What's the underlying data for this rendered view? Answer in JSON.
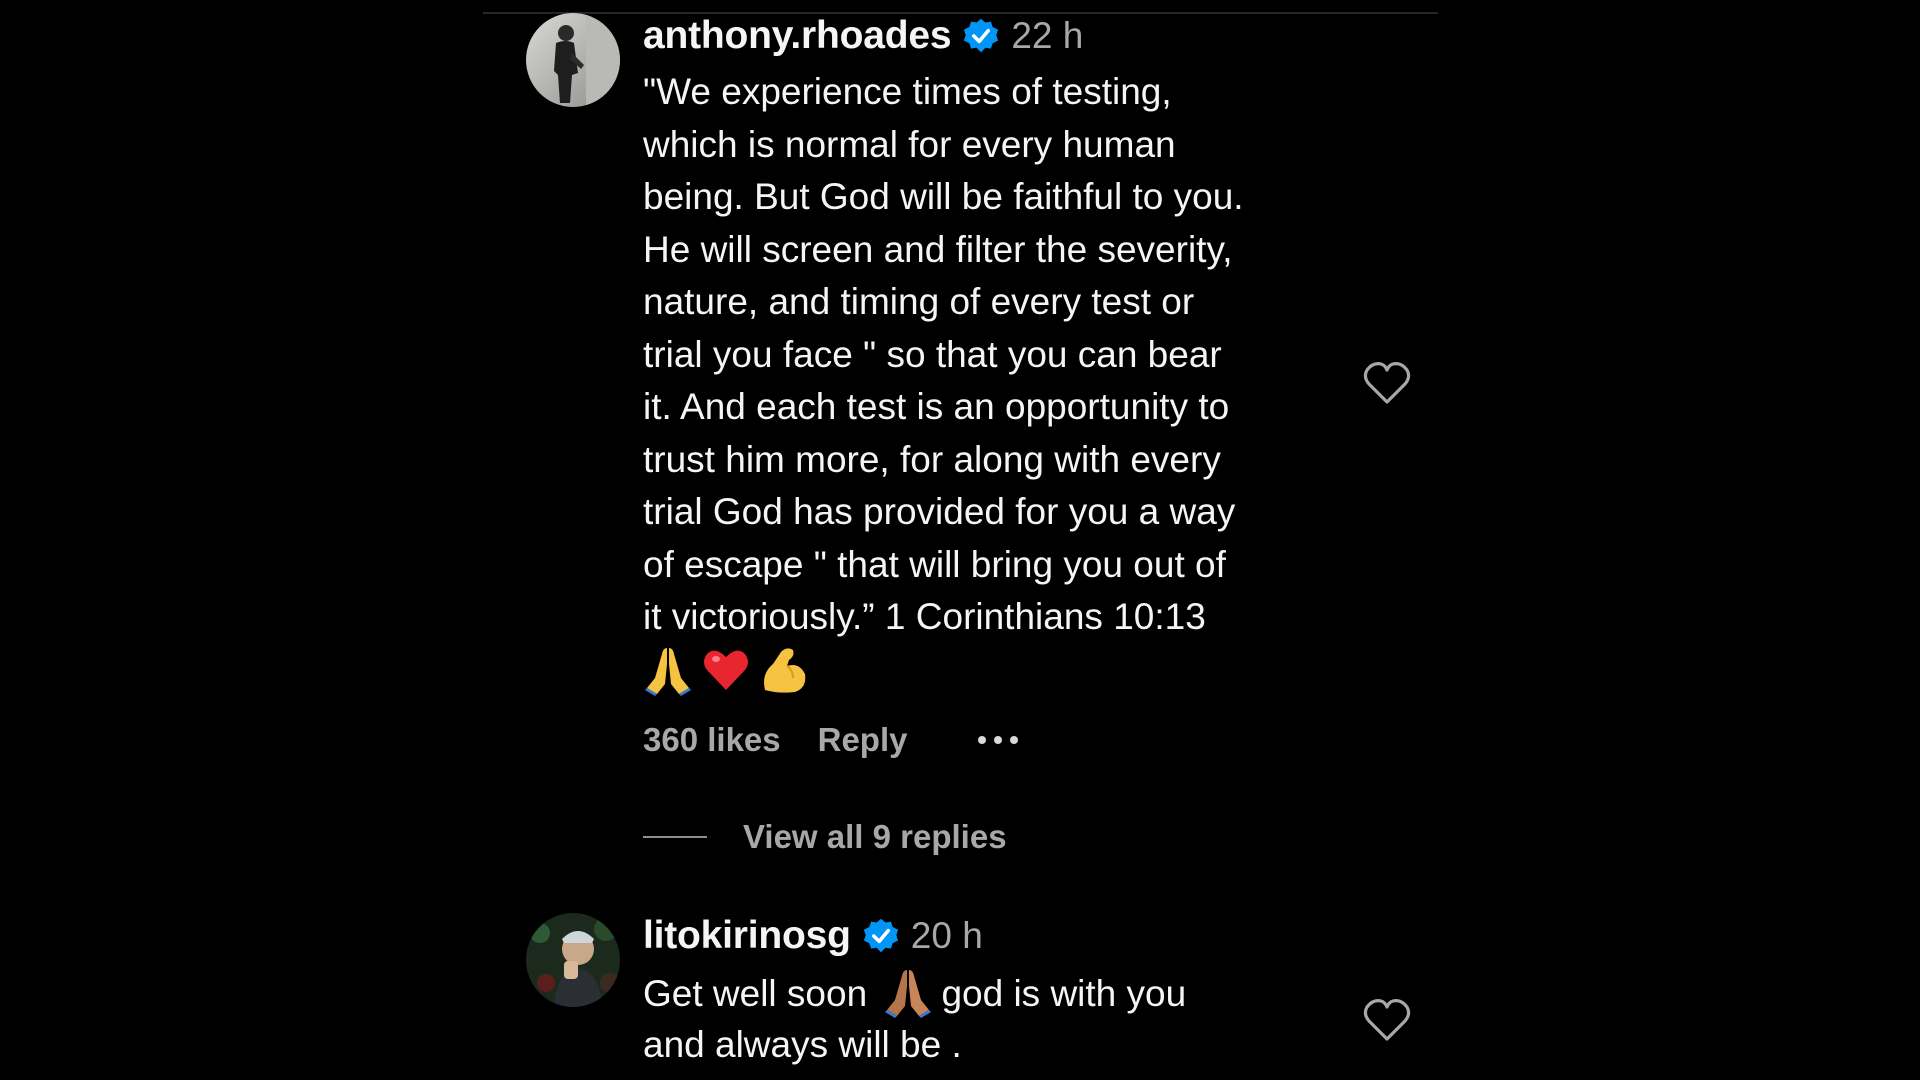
{
  "comments": [
    {
      "username": "anthony.rhoades",
      "verified": true,
      "time": "22 h",
      "text_lines": [
        "\"We experience times of testing,",
        "which is normal for every human",
        "being. But God will be faithful to you.",
        "He will screen and filter the severity,",
        "nature, and timing of every test or",
        "trial you face \" so that you can bear",
        "it. And each test is an opportunity to",
        "trust him more, for along with every",
        "trial God has provided for you a way",
        "of escape \" that will bring you out of",
        "it victoriously.” 1 Corinthians 10:13"
      ],
      "emojis": [
        "folded-hands",
        "red-heart",
        "flexed-biceps"
      ],
      "likes": "360 likes",
      "reply_label": "Reply",
      "view_replies": "View all 9 replies"
    },
    {
      "username": "litokirinosg",
      "verified": true,
      "time": "20 h",
      "text_part1": "Get well soon",
      "text_part2": "god is with you",
      "text_line2": "and always will be .",
      "emoji": "folded-hands-medium-skin"
    }
  ],
  "colors": {
    "background": "#000000",
    "text": "#f5f5f5",
    "secondary_text": "#a8a8a8",
    "verified_blue": "#0095f6"
  }
}
